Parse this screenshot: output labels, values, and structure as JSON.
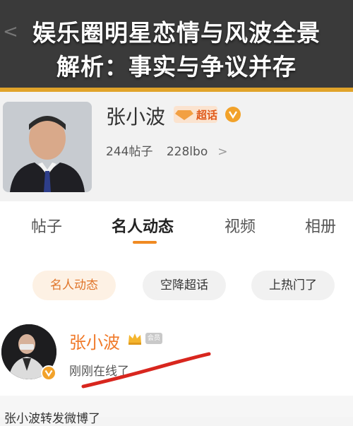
{
  "banner": {
    "title_line1": "娱乐圈明星恋情与风波全景",
    "title_line2": "解析：事实与争议并存",
    "ghost_text": "<"
  },
  "profile": {
    "name": "张小波",
    "badge": "超话",
    "posts": "244帖子",
    "followers": "228lbo",
    "chevron": ">"
  },
  "tabs": [
    {
      "label": "帖子"
    },
    {
      "label": "名人动态"
    },
    {
      "label": "视频"
    },
    {
      "label": "相册"
    }
  ],
  "chips": [
    {
      "label": "名人动态"
    },
    {
      "label": "空降超话"
    },
    {
      "label": "上热门了"
    }
  ],
  "post": {
    "author": "张小波",
    "member_tag": "会员",
    "status": "刚刚在线了"
  },
  "partial_text": "张小波转发微博了",
  "colors": {
    "accent": "#e0a32a",
    "brand_orange": "#f08a22",
    "annotation_red": "#d8261e"
  }
}
